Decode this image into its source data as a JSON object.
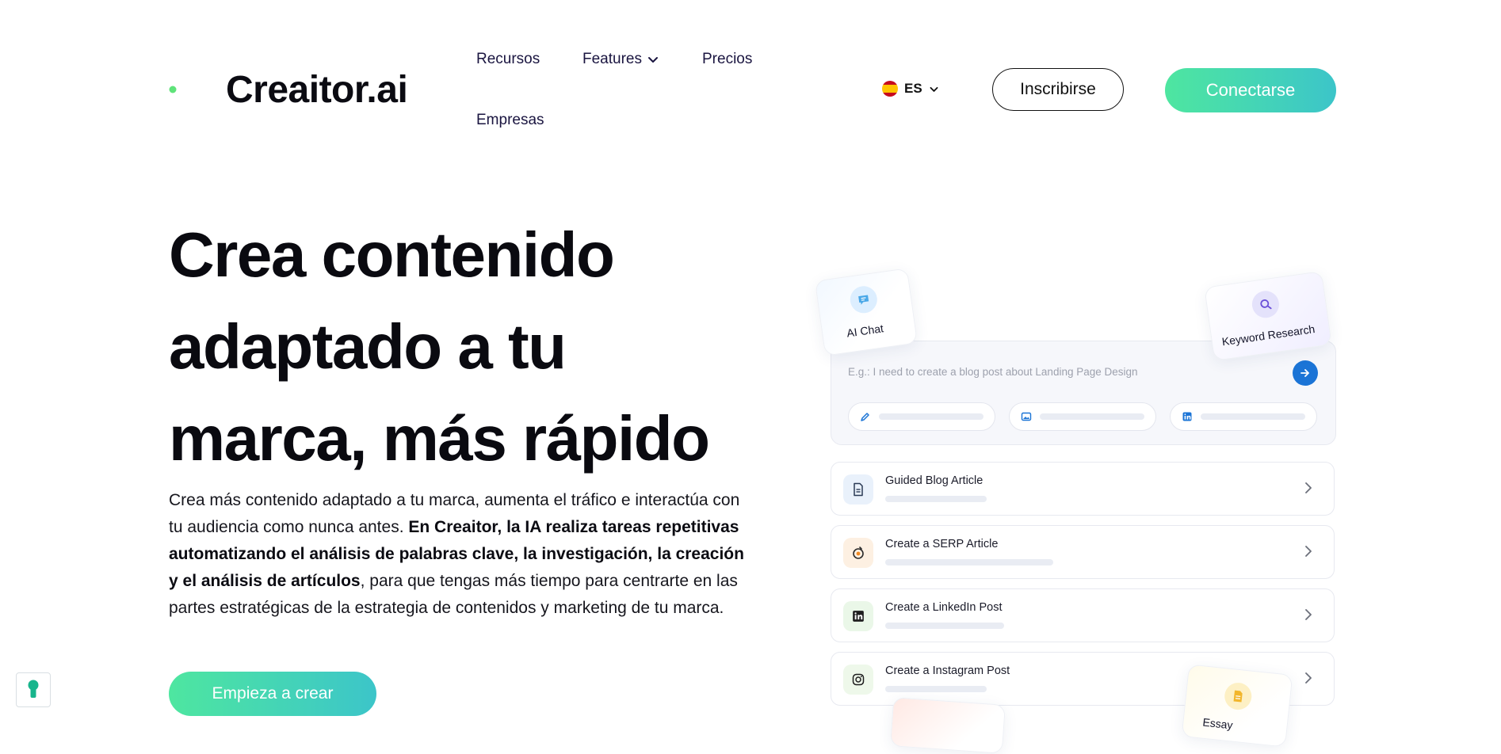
{
  "brand": {
    "name": "Creaitor.ai"
  },
  "nav": {
    "items": [
      {
        "label": "Recursos"
      },
      {
        "label": "Features"
      },
      {
        "label": "Precios"
      },
      {
        "label": "Empresas"
      }
    ]
  },
  "lang": {
    "code": "ES"
  },
  "header": {
    "signup_label": "Inscribirse",
    "login_label": "Conectarse"
  },
  "hero": {
    "title_line1": "Crea contenido",
    "title_line2": "adaptado a tu",
    "title_line3": "marca, más rápido",
    "body_part1": "Crea más contenido adaptado a tu marca, aumenta el tráfico e interactúa con tu audiencia como nunca antes. ",
    "body_bold": "En Creaitor, la IA realiza tareas repetitivas automatizando el análisis de palabras clave, la investigación, la creación y el análisis de artículos",
    "body_part2": ", para que tengas más tiempo para centrarte en las partes estratégicas de la estrategia de contenidos y marketing de tu marca.",
    "cta_label": "Empieza a crear"
  },
  "visual": {
    "ai_chat_label": "AI Chat",
    "keyword_label": "Keyword Research",
    "bottom_chip_label": "Essay",
    "prompt_placeholder": "E.g.: I need to create a blog post about Landing Page Design",
    "cards": [
      {
        "label": "Guided Blog Article"
      },
      {
        "label": "Create a SERP Article"
      },
      {
        "label": "Create a LinkedIn Post"
      },
      {
        "label": "Create a Instagram Post"
      }
    ]
  },
  "colors": {
    "accent_start": "#4ee6a0",
    "accent_end": "#3cc5c9",
    "send_button": "#1b74d6"
  }
}
